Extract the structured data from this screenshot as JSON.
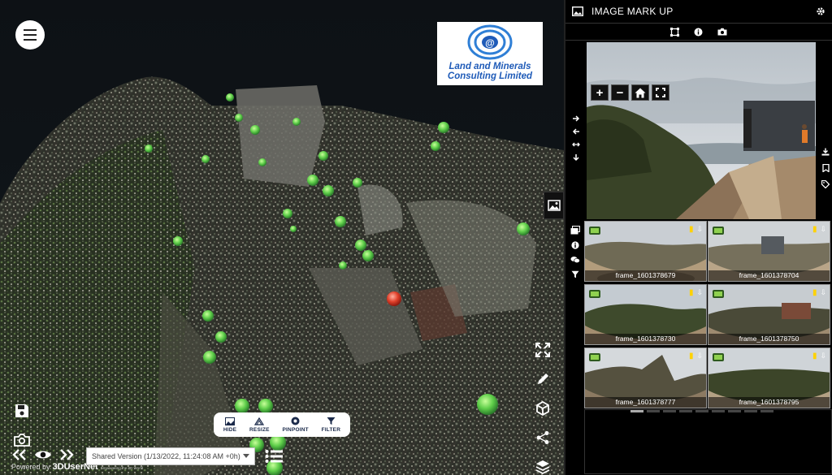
{
  "viewport": {
    "logo": {
      "line1": "Land and Minerals",
      "line2": "Consulting Limited"
    },
    "bottom_toolbar": [
      {
        "label": "HIDE",
        "icon": "image-icon"
      },
      {
        "label": "RESIZE",
        "icon": "resize-icon"
      },
      {
        "label": "PINPOINT",
        "icon": "pinpoint-icon"
      },
      {
        "label": "FILTER",
        "icon": "filter-icon"
      }
    ],
    "version_select": "Shared Version (1/13/2022, 11:24:08 AM +0h)",
    "powered_by": {
      "prefix": "Powered by",
      "brand": "3DUserNet",
      "tagline": "Empowering the 3D World"
    },
    "side_tools": [
      "expand-icon",
      "pencil-icon",
      "cube-icon",
      "share-icon",
      "layers-icon"
    ]
  },
  "panel": {
    "title": "IMAGE MARK UP",
    "tabs": [
      "frame-select-icon",
      "info-icon",
      "camera-icon"
    ],
    "zoom_controls": [
      "+",
      "−"
    ],
    "frames": [
      {
        "label": "frame_1601378679"
      },
      {
        "label": "frame_1601378704"
      },
      {
        "label": "frame_1601378730"
      },
      {
        "label": "frame_1601378750"
      },
      {
        "label": "frame_1601378777"
      },
      {
        "label": "frame_1601378795"
      }
    ]
  }
}
